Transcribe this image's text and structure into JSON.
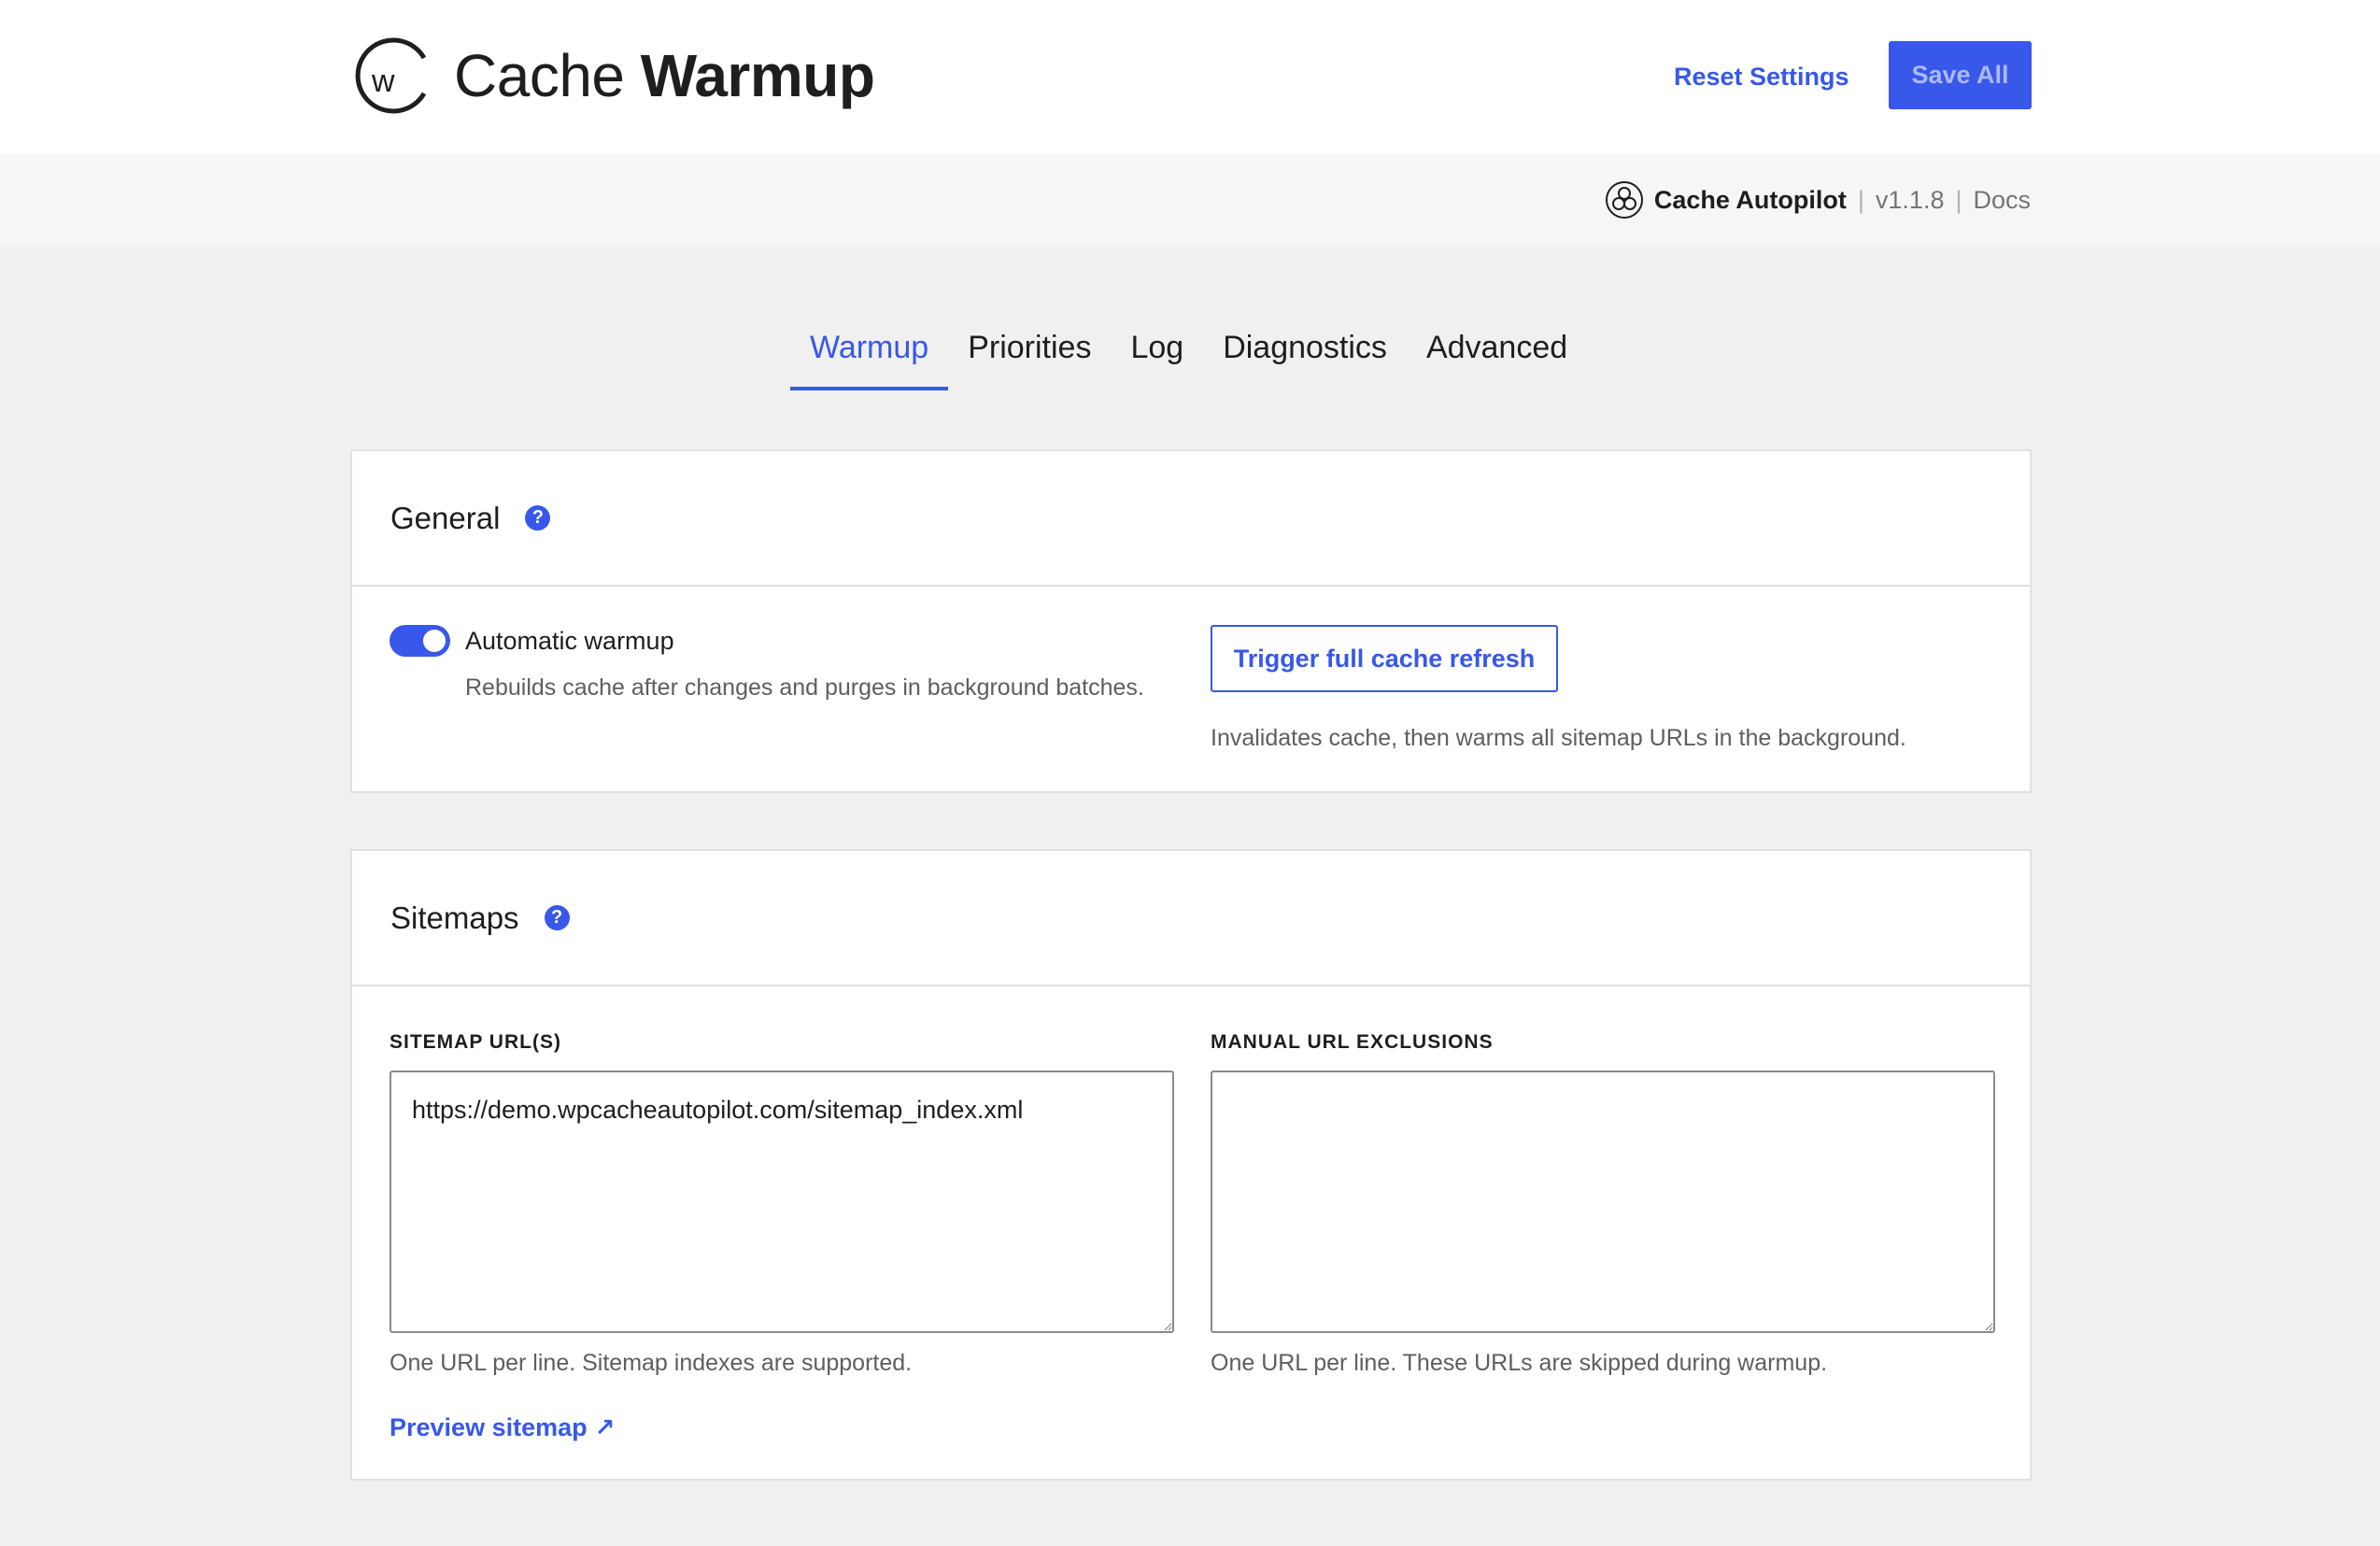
{
  "header": {
    "title_light": "Cache",
    "title_bold": "Warmup",
    "logo_letter": "w",
    "reset_label": "Reset Settings",
    "save_label": "Save All"
  },
  "subheader": {
    "brand_name": "Cache Autopilot",
    "version": "v1.1.8",
    "docs_label": "Docs"
  },
  "tabs": [
    {
      "label": "Warmup",
      "active": true
    },
    {
      "label": "Priorities",
      "active": false
    },
    {
      "label": "Log",
      "active": false
    },
    {
      "label": "Diagnostics",
      "active": false
    },
    {
      "label": "Advanced",
      "active": false
    }
  ],
  "general": {
    "title": "General",
    "auto_warmup_label": "Automatic warmup",
    "auto_warmup_enabled": true,
    "auto_warmup_desc": "Rebuilds cache after changes and purges in background batches.",
    "trigger_label": "Trigger full cache refresh",
    "trigger_desc": "Invalidates cache, then warms all sitemap URLs in the background."
  },
  "sitemaps": {
    "title": "Sitemaps",
    "sitemap_label": "SITEMAP URL(S)",
    "sitemap_value": "https://demo.wpcacheautopilot.com/sitemap_index.xml",
    "sitemap_help": "One URL per line. Sitemap indexes are supported.",
    "exclusions_label": "MANUAL URL EXCLUSIONS",
    "exclusions_value": "",
    "exclusions_help": "One URL per line. These URLs are skipped during warmup.",
    "preview_label": "Preview sitemap",
    "preview_arrow": "↗"
  },
  "colors": {
    "accent": "#3858e9",
    "page_bg": "#f0f0f0",
    "muted_text": "#5e5e5e"
  },
  "icons": {
    "help": "help-circle-icon",
    "brand": "cache-autopilot-icon",
    "logo": "cache-warmup-logo-icon",
    "external": "external-arrow-icon"
  }
}
